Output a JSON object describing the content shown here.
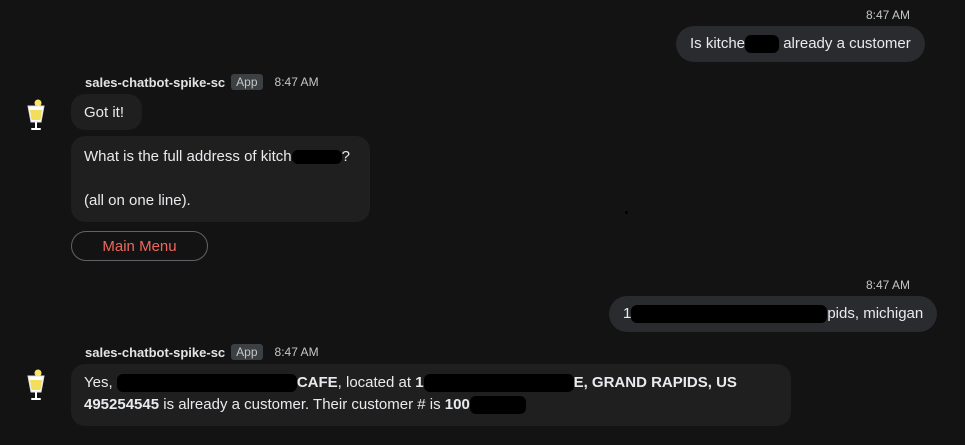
{
  "messages": {
    "user1": {
      "time": "8:47 AM",
      "text_before": "Is kitche",
      "text_after": " already a customer"
    },
    "bot1": {
      "sender": "sales-chatbot-spike-sc",
      "tag": "App",
      "time": "8:47 AM",
      "bubble1": "Got it!",
      "bubble2_line1": "What is the full address of kitch",
      "bubble2_line1_tail": "?",
      "bubble2_line2": "(all on one line).",
      "menu_button": "Main Menu"
    },
    "user2": {
      "time": "8:47 AM",
      "text_before": "1",
      "text_after": "pids, michigan"
    },
    "bot2": {
      "sender": "sales-chatbot-spike-sc",
      "tag": "App",
      "time": "8:47 AM",
      "line1_a": "Yes, ",
      "line1_b": "CAFE",
      "line1_c": ", located at ",
      "line1_d": "1",
      "line1_e": "E, GRAND RAPIDS, US",
      "line2_a": "495254545",
      "line2_b": " is already a customer. Their customer # is ",
      "line2_c": "100"
    }
  },
  "colors": {
    "background": "#131314",
    "bubble": "#1f1f1f",
    "user_bubble": "#2a2b2e",
    "menu_text": "#ee675c"
  },
  "icons": {
    "avatar": "lemon-glass-icon"
  }
}
